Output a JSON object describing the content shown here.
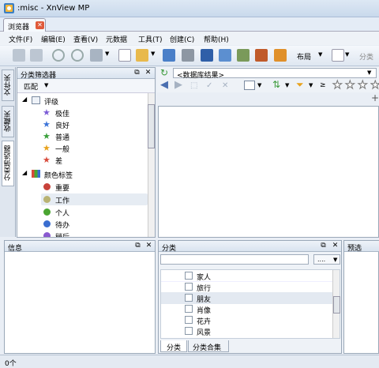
{
  "window": {
    "title": ":misc - XnView MP"
  },
  "tabs": [
    {
      "label": "浏览器",
      "close": "✕"
    }
  ],
  "menu": [
    "文件(F)",
    "编辑(E)",
    "查看(V)",
    "元数据",
    "工具(T)",
    "创建(C)",
    "帮助(H)"
  ],
  "toolbar": {
    "layout_label": "布局",
    "category_label": "分类"
  },
  "side_tabs": [
    "文件夹",
    "收藏夹",
    "分类筛选器"
  ],
  "filter_panel": {
    "title": "分类筛选器",
    "match_label": "匹配",
    "rating_group": "评级",
    "ratings": [
      {
        "label": "极佳",
        "color": "#7b5bd6"
      },
      {
        "label": "良好",
        "color": "#3a73d8"
      },
      {
        "label": "普通",
        "color": "#39a03a"
      },
      {
        "label": "一般",
        "color": "#e8a21c"
      },
      {
        "label": "差",
        "color": "#d84a3a"
      }
    ],
    "color_group": "颜色标签",
    "colors": [
      {
        "label": "重要",
        "color": "#c8423a"
      },
      {
        "label": "工作",
        "color": "#b9b373"
      },
      {
        "label": "个人",
        "color": "#4aa531"
      },
      {
        "label": "待办",
        "color": "#3a6ed0"
      },
      {
        "label": "稍后",
        "color": "#8a5ad0"
      }
    ],
    "selected_index": 1
  },
  "address": {
    "path": "<数据库结果>",
    "compare": "≥"
  },
  "info_panel": {
    "title": "信息"
  },
  "category_panel": {
    "title": "分类",
    "search_placeholder": "",
    "options_button": "....",
    "items": [
      "家人",
      "旅行",
      "朋友",
      "肖像",
      "花卉",
      "风景"
    ],
    "selected_index": 2,
    "tabs": [
      "分类",
      "分类合集"
    ]
  },
  "preview_panel": {
    "title": "预选"
  },
  "status": {
    "text": "0个"
  }
}
